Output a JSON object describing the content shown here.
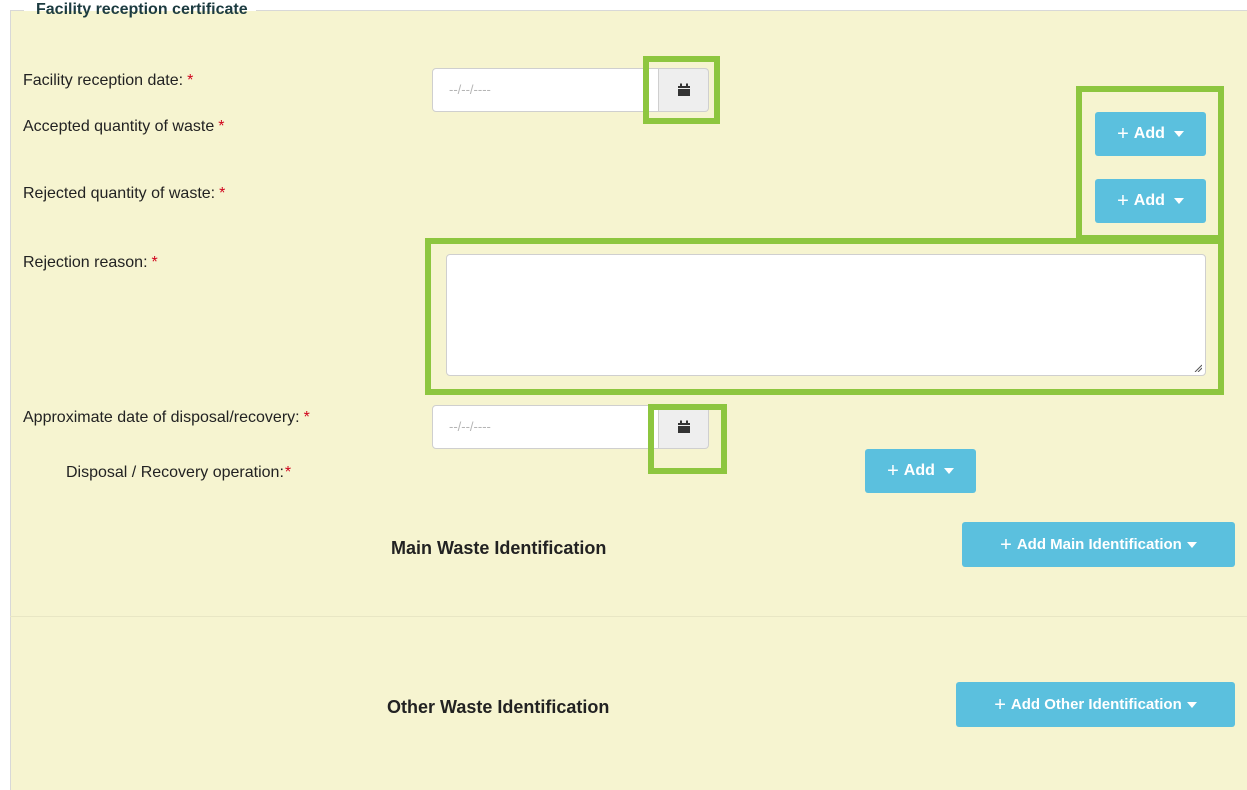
{
  "section": {
    "legend": "Facility reception certificate"
  },
  "fields": {
    "reception_date": {
      "label": "Facility reception date:",
      "required": "*",
      "placeholder": "--/--/----"
    },
    "accepted_quantity": {
      "label": "Accepted quantity of waste",
      "required": "*"
    },
    "rejected_quantity": {
      "label": "Rejected quantity of waste:",
      "required": "*"
    },
    "rejection_reason": {
      "label": "Rejection reason:",
      "required": "*",
      "value": ""
    },
    "disposal_date": {
      "label": "Approximate date of disposal/recovery:",
      "required": "*",
      "placeholder": "--/--/----"
    },
    "operation": {
      "label": "Disposal / Recovery operation:",
      "required": "*"
    }
  },
  "buttons": {
    "add": "Add",
    "add_main_identification": "Add Main Identification",
    "add_other_identification": "Add Other Identification"
  },
  "headings": {
    "main": "Main Waste Identification",
    "other": "Other Waste Identification"
  },
  "icons": {
    "calendar": "calendar-icon",
    "plus": "plus-icon",
    "caret": "caret-down-icon",
    "resize": "resize-grip-icon"
  },
  "colors": {
    "panel_background": "#f6f4d0",
    "button": "#5bc0de",
    "required_marker": "#d0021b",
    "highlight": "#8dc63f"
  }
}
